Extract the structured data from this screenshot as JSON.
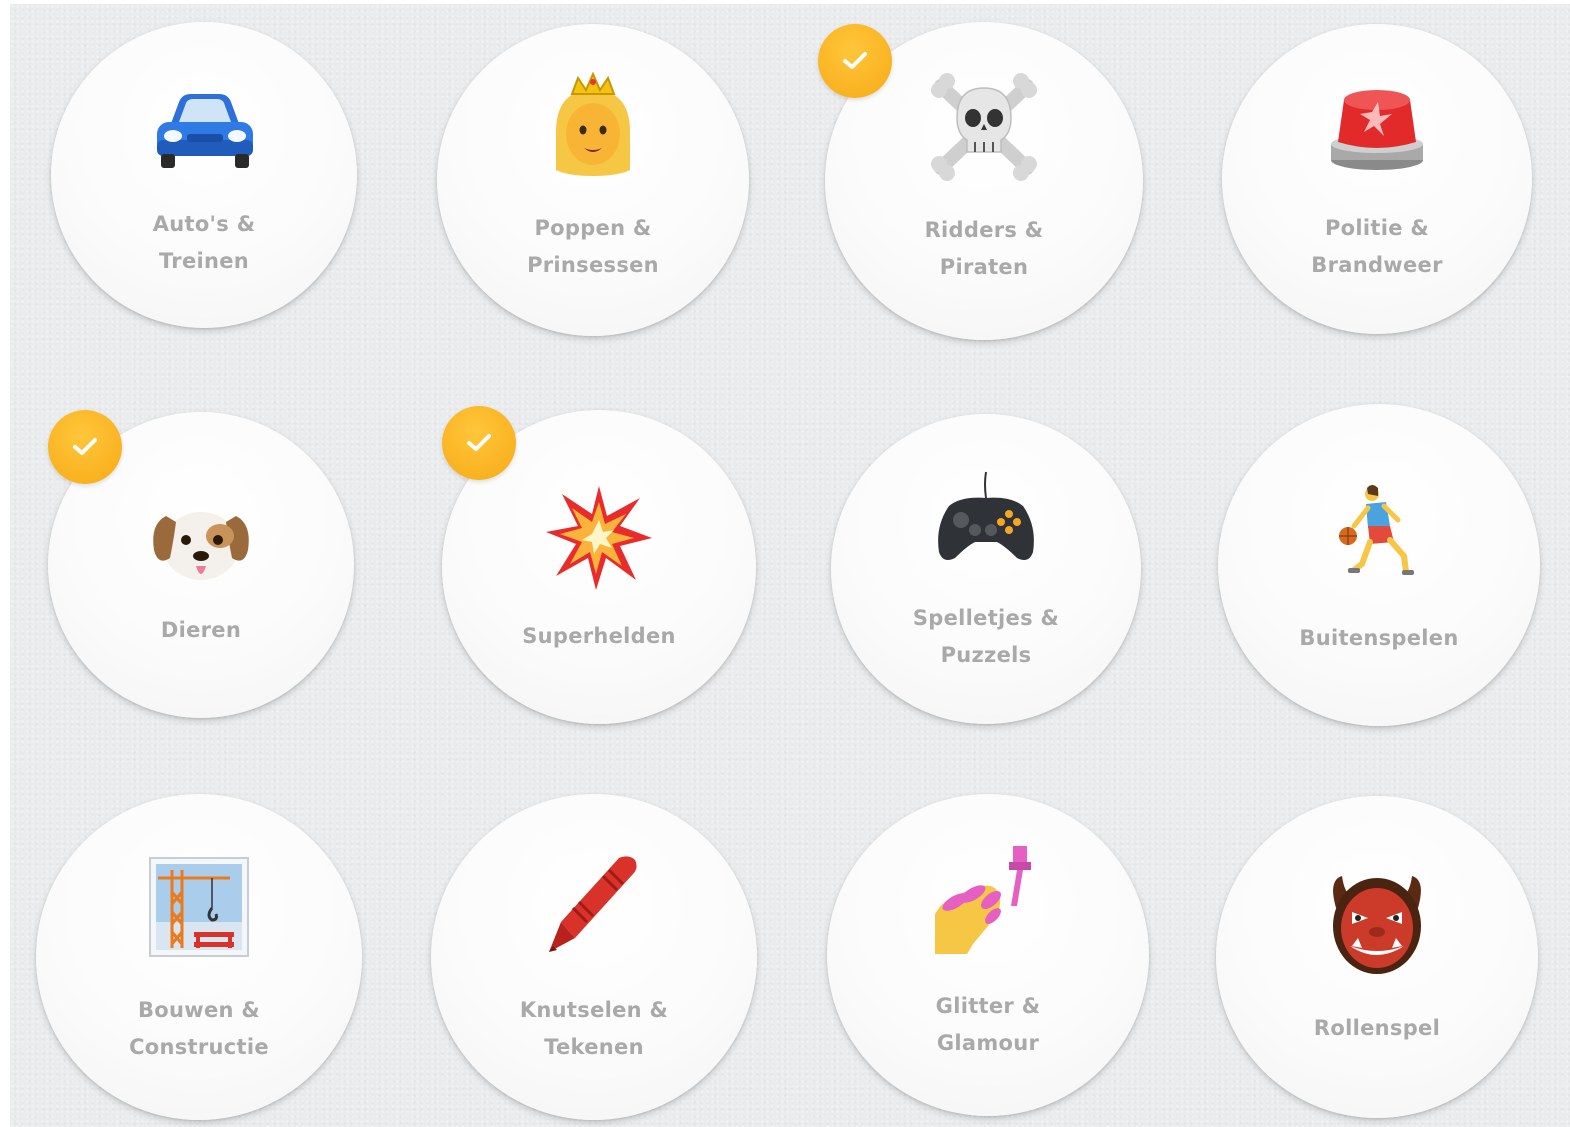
{
  "categories": [
    {
      "line1": "Auto's &",
      "line2": "Treinen",
      "icon": "car-icon",
      "checked": false
    },
    {
      "line1": "Poppen &",
      "line2": "Prinsessen",
      "icon": "princess-icon",
      "checked": false
    },
    {
      "line1": "Ridders &",
      "line2": "Piraten",
      "icon": "skull-crossbones-icon",
      "checked": true
    },
    {
      "line1": "Politie &",
      "line2": "Brandweer",
      "icon": "siren-light-icon",
      "checked": false
    },
    {
      "line1": "Dieren",
      "line2": "",
      "icon": "dog-face-icon",
      "checked": true
    },
    {
      "line1": "Superhelden",
      "line2": "",
      "icon": "explosion-icon",
      "checked": true
    },
    {
      "line1": "Spelletjes &",
      "line2": "Puzzels",
      "icon": "game-controller-icon",
      "checked": false
    },
    {
      "line1": "Buitenspelen",
      "line2": "",
      "icon": "basketball-player-icon",
      "checked": false
    },
    {
      "line1": "Bouwen &",
      "line2": "Constructie",
      "icon": "construction-crane-icon",
      "checked": false
    },
    {
      "line1": "Knutselen &",
      "line2": "Tekenen",
      "icon": "crayon-icon",
      "checked": false
    },
    {
      "line1": "Glitter &",
      "line2": "Glamour",
      "icon": "nail-polish-icon",
      "checked": false
    },
    {
      "line1": "Rollenspel",
      "line2": "",
      "icon": "ogre-mask-icon",
      "checked": false
    }
  ],
  "colors": {
    "background": "#e9ebec",
    "card": "#fbfbfb",
    "label": "#a9a9a9",
    "check_badge": "#f7aa16"
  }
}
